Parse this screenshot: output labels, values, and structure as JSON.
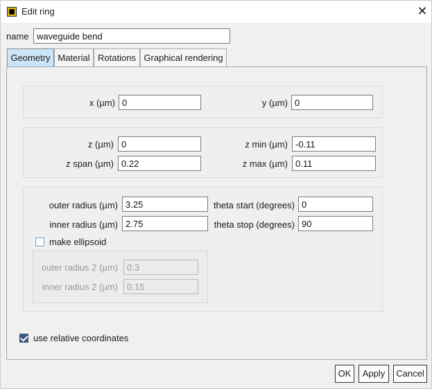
{
  "window": {
    "title": "Edit ring"
  },
  "name_field": {
    "label": "name",
    "value": "waveguide bend"
  },
  "tabs": [
    {
      "label": "Geometry"
    },
    {
      "label": "Material"
    },
    {
      "label": "Rotations"
    },
    {
      "label": "Graphical rendering"
    }
  ],
  "geometry": {
    "x": {
      "label": "x (µm)",
      "value": "0"
    },
    "y": {
      "label": "y (µm)",
      "value": "0"
    },
    "z": {
      "label": "z (µm)",
      "value": "0"
    },
    "z_min": {
      "label": "z min (µm)",
      "value": "-0.11"
    },
    "z_span": {
      "label": "z span (µm)",
      "value": "0.22"
    },
    "z_max": {
      "label": "z max (µm)",
      "value": "0.11"
    },
    "outer_radius": {
      "label": "outer radius (µm)",
      "value": "3.25"
    },
    "inner_radius": {
      "label": "inner radius (µm)",
      "value": "2.75"
    },
    "theta_start": {
      "label": "theta start (degrees)",
      "value": "0"
    },
    "theta_stop": {
      "label": "theta stop (degrees)",
      "value": "90"
    },
    "make_ellipsoid": {
      "label": "make ellipsoid",
      "checked": false
    },
    "outer_radius_2": {
      "label": "outer radius 2 (µm)",
      "value": "0.3"
    },
    "inner_radius_2": {
      "label": "inner radius 2 (µm)",
      "value": "0.15"
    },
    "use_relative": {
      "label": "use relative coordinates",
      "checked": true
    }
  },
  "buttons": {
    "ok": "OK",
    "apply": "Apply",
    "cancel": "Cancel"
  },
  "colors": {
    "active_tab": "#cce4f7",
    "checkbox_checked": "#3d5a7f",
    "app_icon": "#f2c200"
  }
}
